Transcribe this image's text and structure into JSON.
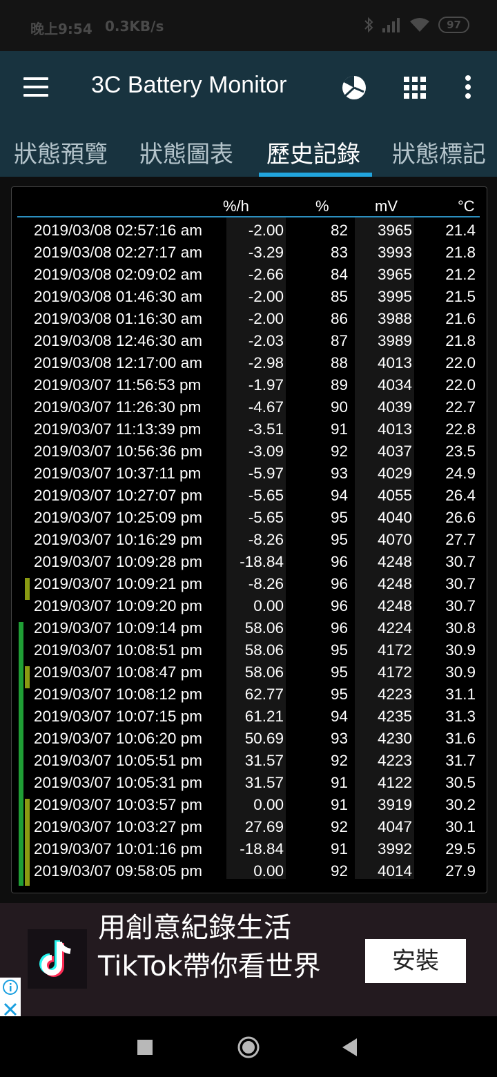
{
  "status_bar": {
    "time": "晚上9:54",
    "net_speed": "0.3KB/s",
    "battery": "97"
  },
  "app": {
    "title": "3C Battery Monitor"
  },
  "tabs": [
    {
      "label": "狀態預覽",
      "active": false
    },
    {
      "label": "狀態圖表",
      "active": false
    },
    {
      "label": "歷史記錄",
      "active": true
    },
    {
      "label": "狀態標記",
      "active": false
    }
  ],
  "table": {
    "headers": {
      "rate": "%/h",
      "pct": "%",
      "mv": "mV",
      "temp": "°C"
    },
    "rows": [
      {
        "dt": "2019/03/08  02:57:16 am",
        "rate": "-2.00",
        "pct": "82",
        "mv": "3965",
        "temp": "21.4"
      },
      {
        "dt": "2019/03/08  02:27:17 am",
        "rate": "-3.29",
        "pct": "83",
        "mv": "3993",
        "temp": "21.8"
      },
      {
        "dt": "2019/03/08  02:09:02 am",
        "rate": "-2.66",
        "pct": "84",
        "mv": "3965",
        "temp": "21.2"
      },
      {
        "dt": "2019/03/08  01:46:30 am",
        "rate": "-2.00",
        "pct": "85",
        "mv": "3995",
        "temp": "21.5"
      },
      {
        "dt": "2019/03/08  01:16:30 am",
        "rate": "-2.00",
        "pct": "86",
        "mv": "3988",
        "temp": "21.6"
      },
      {
        "dt": "2019/03/08  12:46:30 am",
        "rate": "-2.03",
        "pct": "87",
        "mv": "3989",
        "temp": "21.8"
      },
      {
        "dt": "2019/03/08  12:17:00 am",
        "rate": "-2.98",
        "pct": "88",
        "mv": "4013",
        "temp": "22.0"
      },
      {
        "dt": "2019/03/07  11:56:53 pm",
        "rate": "-1.97",
        "pct": "89",
        "mv": "4034",
        "temp": "22.0"
      },
      {
        "dt": "2019/03/07  11:26:30 pm",
        "rate": "-4.67",
        "pct": "90",
        "mv": "4039",
        "temp": "22.7"
      },
      {
        "dt": "2019/03/07  11:13:39 pm",
        "rate": "-3.51",
        "pct": "91",
        "mv": "4013",
        "temp": "22.8"
      },
      {
        "dt": "2019/03/07  10:56:36 pm",
        "rate": "-3.09",
        "pct": "92",
        "mv": "4037",
        "temp": "23.5"
      },
      {
        "dt": "2019/03/07  10:37:11 pm",
        "rate": "-5.97",
        "pct": "93",
        "mv": "4029",
        "temp": "24.9"
      },
      {
        "dt": "2019/03/07  10:27:07 pm",
        "rate": "-5.65",
        "pct": "94",
        "mv": "4055",
        "temp": "26.4"
      },
      {
        "dt": "2019/03/07  10:25:09 pm",
        "rate": "-5.65",
        "pct": "95",
        "mv": "4040",
        "temp": "26.6"
      },
      {
        "dt": "2019/03/07  10:16:29 pm",
        "rate": "-8.26",
        "pct": "95",
        "mv": "4070",
        "temp": "27.7"
      },
      {
        "dt": "2019/03/07  10:09:28 pm",
        "rate": "-18.84",
        "pct": "96",
        "mv": "4248",
        "temp": "30.7"
      },
      {
        "dt": "2019/03/07  10:09:21 pm",
        "rate": "-8.26",
        "pct": "96",
        "mv": "4248",
        "temp": "30.7"
      },
      {
        "dt": "2019/03/07  10:09:20 pm",
        "rate": "0.00",
        "pct": "96",
        "mv": "4248",
        "temp": "30.7"
      },
      {
        "dt": "2019/03/07  10:09:14 pm",
        "rate": "58.06",
        "pct": "96",
        "mv": "4224",
        "temp": "30.8"
      },
      {
        "dt": "2019/03/07  10:08:51 pm",
        "rate": "58.06",
        "pct": "95",
        "mv": "4172",
        "temp": "30.9"
      },
      {
        "dt": "2019/03/07  10:08:47 pm",
        "rate": "58.06",
        "pct": "95",
        "mv": "4172",
        "temp": "30.9"
      },
      {
        "dt": "2019/03/07  10:08:12 pm",
        "rate": "62.77",
        "pct": "95",
        "mv": "4223",
        "temp": "31.1"
      },
      {
        "dt": "2019/03/07  10:07:15 pm",
        "rate": "61.21",
        "pct": "94",
        "mv": "4235",
        "temp": "31.3"
      },
      {
        "dt": "2019/03/07  10:06:20 pm",
        "rate": "50.69",
        "pct": "93",
        "mv": "4230",
        "temp": "31.6"
      },
      {
        "dt": "2019/03/07  10:05:51 pm",
        "rate": "31.57",
        "pct": "92",
        "mv": "4223",
        "temp": "31.7"
      },
      {
        "dt": "2019/03/07  10:05:31 pm",
        "rate": "31.57",
        "pct": "91",
        "mv": "4122",
        "temp": "30.5"
      },
      {
        "dt": "2019/03/07  10:03:57 pm",
        "rate": "0.00",
        "pct": "91",
        "mv": "3919",
        "temp": "30.2"
      },
      {
        "dt": "2019/03/07  10:03:27 pm",
        "rate": "27.69",
        "pct": "92",
        "mv": "4047",
        "temp": "30.1"
      },
      {
        "dt": "2019/03/07  10:01:16 pm",
        "rate": "-18.84",
        "pct": "91",
        "mv": "3992",
        "temp": "29.5"
      },
      {
        "dt": "2019/03/07  09:58:05 pm",
        "rate": "0.00",
        "pct": "92",
        "mv": "4014",
        "temp": "27.9"
      }
    ]
  },
  "ad": {
    "text": "用創意紀錄生活TikTok帶你看世界",
    "install_label": "安裝"
  },
  "colors": {
    "appbar": "#18333f",
    "tab_indicator": "#21a5de",
    "charging_green": "#1f9e35",
    "marker_olive": "#8a9a12"
  },
  "icons": [
    "menu-icon",
    "pie-chart-icon",
    "grid-icon",
    "more-vert-icon",
    "bluetooth-icon",
    "signal-icon",
    "wifi-icon",
    "tiktok-logo-icon",
    "ad-info-icon",
    "ad-close-icon",
    "nav-recents-icon",
    "nav-home-icon",
    "nav-back-icon"
  ]
}
